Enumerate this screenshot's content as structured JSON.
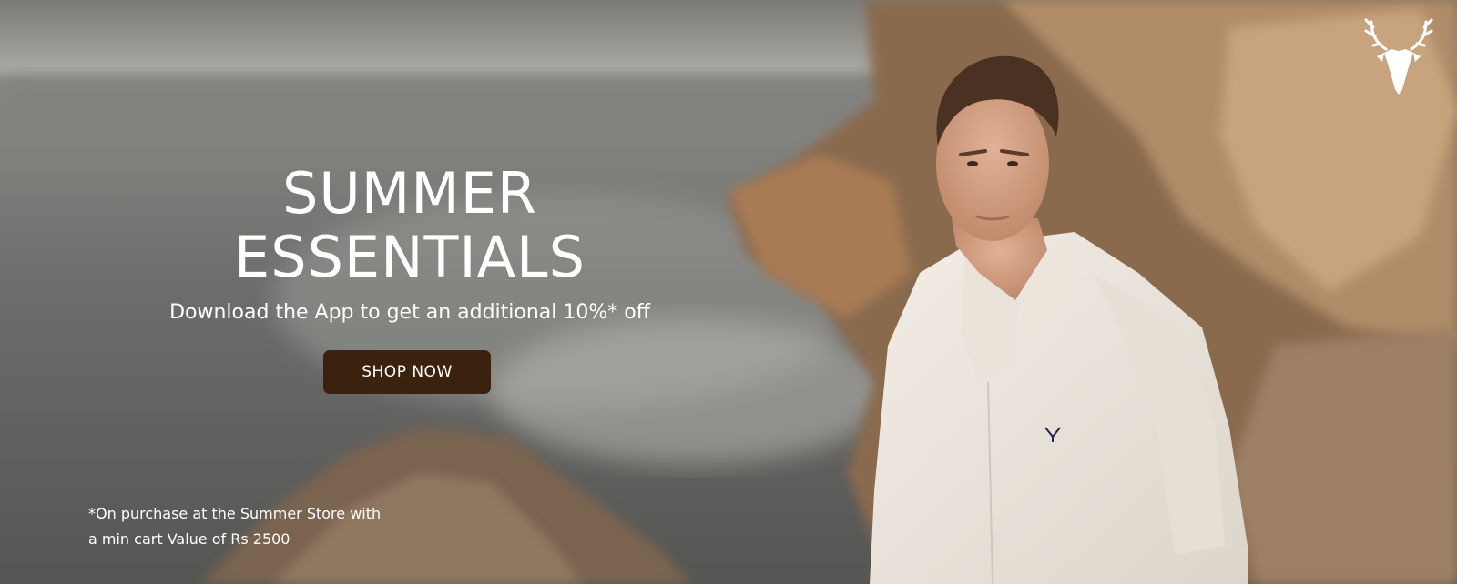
{
  "banner": {
    "headline_line1": "SUMMER",
    "headline_line2": "ESSENTIALS",
    "subline": "Download the App to get an additional 10%* off",
    "cta_label": "SHOP NOW",
    "disclaimer_line1": "*On purchase at the Summer Store with",
    "disclaimer_line2": "a min cart Value of Rs 2500"
  },
  "icons": {
    "brand_logo": "stag-head-icon"
  },
  "colors": {
    "cta_background": "#3b220e",
    "text": "#ffffff"
  }
}
